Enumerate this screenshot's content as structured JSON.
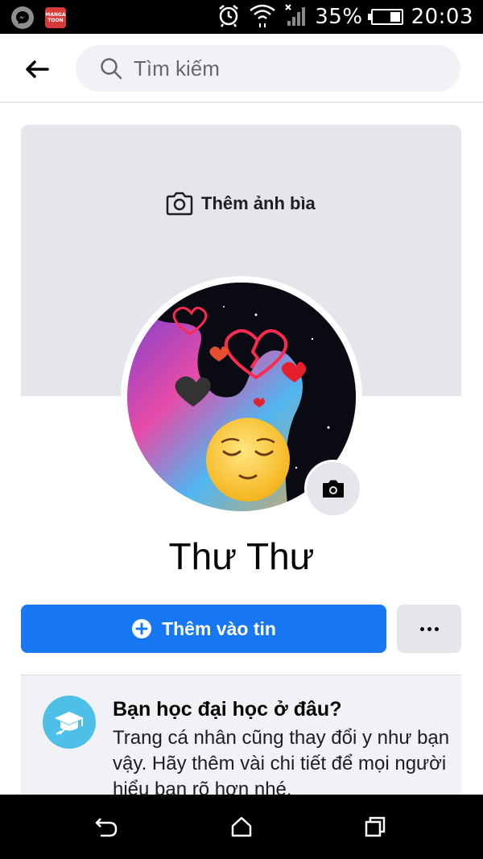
{
  "status_bar": {
    "battery": "35%",
    "battery_level": 0.35,
    "time": "20:03",
    "apps": [
      "messenger-icon",
      "mangatoon-icon"
    ],
    "mangatoon_label": "MANGA TOON"
  },
  "header": {
    "search_placeholder": "Tìm kiếm"
  },
  "cover": {
    "add_cover_label": "Thêm ảnh bìa"
  },
  "profile": {
    "name": "Thư Thư"
  },
  "actions": {
    "add_story_label": "Thêm vào tin"
  },
  "education_card": {
    "title": "Bạn học đại học ở đâu?",
    "body": "Trang cá nhân cũng thay đổi y như bạn vậy. Hãy thêm vài chi tiết để mọi người hiểu bạn rõ hơn nhé."
  },
  "colors": {
    "accent": "#1877f2",
    "cover_bg": "#e4e6eb",
    "card_bg": "#f0f2f5",
    "edu_icon_bg": "#4ec0e8"
  }
}
